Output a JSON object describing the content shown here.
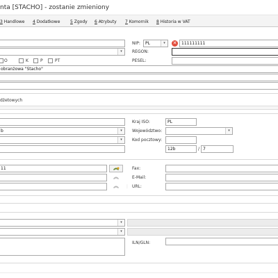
{
  "window": {
    "title": "nta [STACHO] - zostanie zmieniony"
  },
  "tabs": [
    {
      "key": "3",
      "label": " Handlowe"
    },
    {
      "key": "4",
      "label": " Dodatkowe"
    },
    {
      "key": "5",
      "label": " Zgody"
    },
    {
      "key": "6",
      "label": " Atrybuty"
    },
    {
      "key": "7",
      "label": " Komornik"
    },
    {
      "key": "8",
      "label": " Historia w VAT"
    }
  ],
  "general": {
    "nip_label": "NIP:",
    "nip_prefix": "PL",
    "nip_value": "111111111",
    "regon_label": "REGON:",
    "pesel_label": "PESEL:",
    "checkboxes": [
      {
        "label": "O"
      },
      {
        "label": "K"
      },
      {
        "label": "P"
      },
      {
        "label": "PT"
      }
    ],
    "name_line": "obranżowa \"Stacho\""
  },
  "section_label": "dżetowych",
  "address": {
    "country_label": "Kraj ISO:",
    "country_value": "PL",
    "left_combo_value": "b",
    "voivodeship_label": "Województwo:",
    "postal_label": "Kod pocztowy:",
    "house_no": "12b",
    "slash": "/",
    "apt_no": "7"
  },
  "contact": {
    "phone_value": "11",
    "fax_label": "Fax:",
    "email_label": "E-Mail:",
    "url_label": "URL:"
  },
  "bottom": {
    "iln_label": "ILN/GLN:"
  },
  "icons": {
    "dropdown": "▾",
    "error": "✕"
  }
}
